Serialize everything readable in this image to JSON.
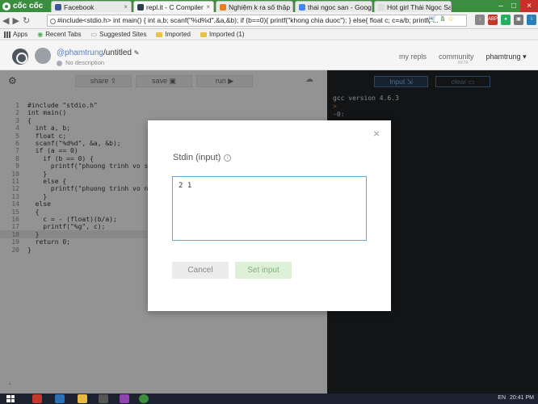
{
  "browser": {
    "brand": "cốc cốc",
    "tabs": [
      {
        "title": "Facebook",
        "color": "#3b5998",
        "active": false
      },
      {
        "title": "repl.it - C Compiler",
        "color": "#2c3e50",
        "active": true
      },
      {
        "title": "Nghiệm k ra số thập p",
        "color": "#e67e22",
        "active": false
      },
      {
        "title": "thai ngoc san - Googl",
        "color": "#4285f4",
        "active": false
      },
      {
        "title": "Hot girl Thái Ngọc San",
        "color": "#dddddd",
        "active": false
      }
    ],
    "address": "#include<stdio.h> int main() { int a,b; scanf(\"%d%d\",&a,&b); if (b==0){ printf(\"khong chia duoc\"); } else{ float c; c=a/b; printf(\"..."
  },
  "bookmarks": [
    "Apps",
    "Recent Tabs",
    "Suggested Sites",
    "Imported",
    "Imported (1)"
  ],
  "header": {
    "user": "@phamtrung",
    "project": "untitled",
    "description": "No description",
    "nav": [
      "my repls",
      "community",
      "phamtrung"
    ],
    "beta": "BETA"
  },
  "toolbar": {
    "share": "share",
    "save": "save",
    "run": "run"
  },
  "code": [
    "#include \"stdio.h\"",
    "int main()",
    "{",
    "  int a, b;",
    "  float c;",
    "  scanf(\"%d%d\", &a, &b);",
    "  if (a == 0)",
    "    if (b == 0) {",
    "      printf(\"phuong trinh vo so n",
    "    }",
    "    else {",
    "      printf(\"phuong trinh vo nghi",
    "    }",
    "  else",
    "  {",
    "    c = - (float)(b/a);",
    "    printf(\"%g\", c);",
    "  }",
    "  return 0;",
    "}"
  ],
  "line_numbers": [
    "1",
    "2",
    "3",
    "4",
    "5",
    "6",
    "7",
    "8",
    "9",
    "10",
    "11",
    "12",
    "13",
    "14",
    "15",
    "16",
    "17",
    "18",
    "19",
    "20"
  ],
  "console": {
    "input_label": "Input",
    "clear_label": "clear",
    "lines": [
      "gcc version 4.6.3",
      "> ",
      "-0: "
    ]
  },
  "dialog": {
    "title": "Stdin (input)",
    "value": "2 1",
    "cancel": "Cancel",
    "set_input": "Set input"
  },
  "taskbar": {
    "lang": "EN",
    "time": "20:41 PM"
  }
}
